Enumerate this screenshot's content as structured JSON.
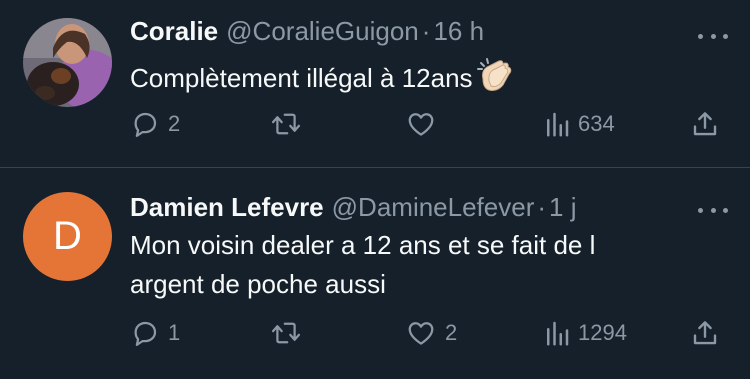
{
  "tweets": [
    {
      "name": "Coralie",
      "handle": "@CoralieGuigon",
      "separator": "·",
      "time": "16 h",
      "text": "Complètement illégal à 12ans",
      "emoji": "clapping-hands",
      "replies": "2",
      "retweets": "",
      "likes": "",
      "views": "634"
    },
    {
      "name": "Damien Lefevre",
      "handle": "@DamineLefever",
      "separator": "·",
      "time": "1 j",
      "avatar_letter": "D",
      "avatar_color": "#e57536",
      "text_line1": "Mon voisin dealer a 12 ans et se fait de l",
      "text_line2": "argent de poche aussi",
      "replies": "1",
      "retweets": "",
      "likes": "2",
      "views": "1294"
    }
  ],
  "colors": {
    "background": "#15202b",
    "text": "#f7f9f9",
    "secondary": "#8b98a5",
    "divider": "#38444d"
  }
}
